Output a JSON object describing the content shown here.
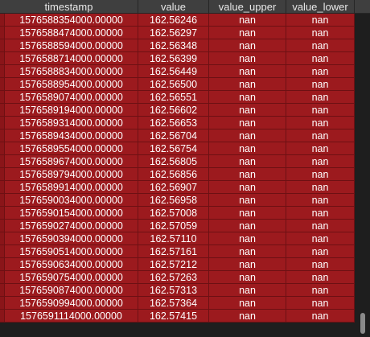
{
  "table": {
    "columns": [
      "timestamp",
      "value",
      "value_upper",
      "value_lower"
    ],
    "rows": [
      [
        "1576588354000.00000",
        "162.56246",
        "nan",
        "nan"
      ],
      [
        "1576588474000.00000",
        "162.56297",
        "nan",
        "nan"
      ],
      [
        "1576588594000.00000",
        "162.56348",
        "nan",
        "nan"
      ],
      [
        "1576588714000.00000",
        "162.56399",
        "nan",
        "nan"
      ],
      [
        "1576588834000.00000",
        "162.56449",
        "nan",
        "nan"
      ],
      [
        "1576588954000.00000",
        "162.56500",
        "nan",
        "nan"
      ],
      [
        "1576589074000.00000",
        "162.56551",
        "nan",
        "nan"
      ],
      [
        "1576589194000.00000",
        "162.56602",
        "nan",
        "nan"
      ],
      [
        "1576589314000.00000",
        "162.56653",
        "nan",
        "nan"
      ],
      [
        "1576589434000.00000",
        "162.56704",
        "nan",
        "nan"
      ],
      [
        "1576589554000.00000",
        "162.56754",
        "nan",
        "nan"
      ],
      [
        "1576589674000.00000",
        "162.56805",
        "nan",
        "nan"
      ],
      [
        "1576589794000.00000",
        "162.56856",
        "nan",
        "nan"
      ],
      [
        "1576589914000.00000",
        "162.56907",
        "nan",
        "nan"
      ],
      [
        "1576590034000.00000",
        "162.56958",
        "nan",
        "nan"
      ],
      [
        "1576590154000.00000",
        "162.57008",
        "nan",
        "nan"
      ],
      [
        "1576590274000.00000",
        "162.57059",
        "nan",
        "nan"
      ],
      [
        "1576590394000.00000",
        "162.57110",
        "nan",
        "nan"
      ],
      [
        "1576590514000.00000",
        "162.57161",
        "nan",
        "nan"
      ],
      [
        "1576590634000.00000",
        "162.57212",
        "nan",
        "nan"
      ],
      [
        "1576590754000.00000",
        "162.57263",
        "nan",
        "nan"
      ],
      [
        "1576590874000.00000",
        "162.57313",
        "nan",
        "nan"
      ],
      [
        "1576590994000.00000",
        "162.57364",
        "nan",
        "nan"
      ],
      [
        "1576591114000.00000",
        "162.57415",
        "nan",
        "nan"
      ]
    ]
  },
  "colors": {
    "header_bg": "#3f3f3f",
    "row_highlight": "#9c1a1e",
    "background": "#1e1e1e"
  }
}
